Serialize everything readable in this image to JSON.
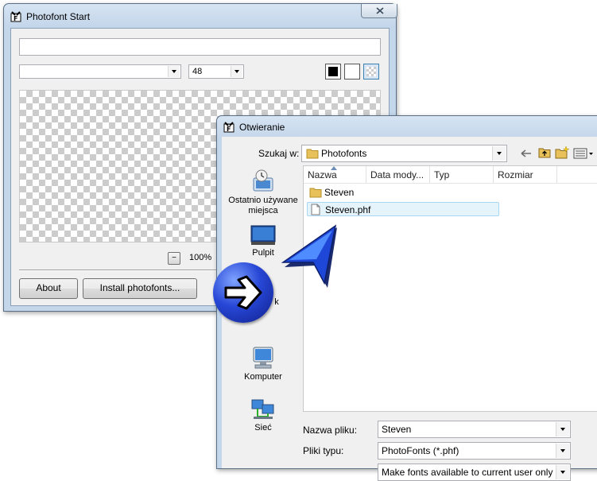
{
  "photofont_window": {
    "title": "Photofont Start",
    "text_input_value": "",
    "font_select_value": "",
    "size_select_value": "48",
    "zoom_minus": "−",
    "zoom_value": "100%",
    "about_label": "About",
    "install_label": "Install photofonts..."
  },
  "open_dialog": {
    "title": "Otwieranie",
    "look_in_label": "Szukaj w:",
    "look_in_value": "Photofonts",
    "columns": [
      "Nazwa",
      "Data mody...",
      "Typ",
      "Rozmiar"
    ],
    "files": [
      {
        "name": "Steven",
        "kind": "folder"
      },
      {
        "name": "Steven.phf",
        "kind": "file"
      }
    ],
    "places": [
      {
        "label": "Ostatnio używane miejsca",
        "icon": "recent-places-icon"
      },
      {
        "label": "Pulpit",
        "icon": "desktop-icon"
      },
      {
        "label": "k",
        "icon": "library-icon"
      },
      {
        "label": "Komputer",
        "icon": "computer-icon"
      },
      {
        "label": "Sieć",
        "icon": "network-icon"
      }
    ],
    "filename_label": "Nazwa pliku:",
    "filename_value": "Steven",
    "filetype_label": "Pliki typu:",
    "filetype_value": "PhotoFonts (*.phf)",
    "install_scope_value": "Make fonts available to current user only"
  },
  "colors": {
    "title_bar": "#c4d6ea",
    "client_bg": "#f0f0f0",
    "selection": "#e5f3fb",
    "arrow_blue": "#1a3fcf"
  }
}
